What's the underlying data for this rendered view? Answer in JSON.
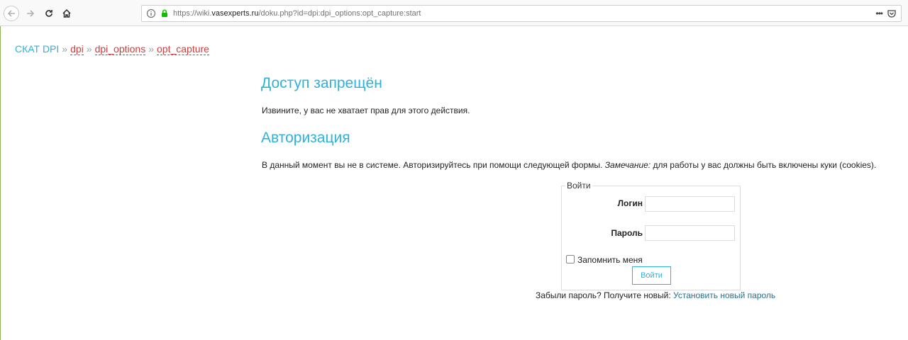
{
  "browser": {
    "url_prefix": "https://wiki.",
    "url_host": "vasexperts.ru",
    "url_path": "/doku.php?id=dpi:dpi_options:opt_capture:start",
    "more_menu": "•••"
  },
  "breadcrumb": {
    "root": "СКАТ DPI",
    "sep": "»",
    "items": [
      {
        "label": "dpi"
      },
      {
        "label": "dpi_options"
      },
      {
        "label": "opt_capture"
      }
    ]
  },
  "denied": {
    "title": "Доступ запрещён",
    "text": "Извините, у вас не хватает прав для этого действия."
  },
  "auth": {
    "title": "Авторизация",
    "text_before": "В данный момент вы не в системе. Авторизируйтесь при помощи следующей формы. ",
    "note": "Замечание:",
    "text_after": " для работы у вас должны быть включены куки (cookies)."
  },
  "login_form": {
    "legend": "Войти",
    "login_label": "Логин",
    "login_value": "",
    "password_label": "Пароль",
    "password_value": "",
    "remember_label": "Запомнить меня",
    "submit_label": "Войти"
  },
  "forgot": {
    "text": "Забыли пароль? Получите новый: ",
    "link": "Установить новый пароль"
  },
  "colors": {
    "accent": "#2eb2d9",
    "breadcrumb_link": "#d33a3a",
    "link": "#2b6f8a"
  }
}
